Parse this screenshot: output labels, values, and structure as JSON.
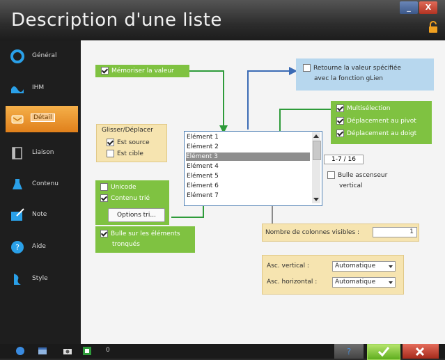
{
  "window": {
    "title": "Description d'une liste",
    "minimize_label": "_",
    "close_label": "X"
  },
  "sidebar": {
    "items": [
      {
        "label": "Général",
        "icon": "circle-icon"
      },
      {
        "label": "IHM",
        "icon": "screen-icon"
      },
      {
        "label": "Détail",
        "icon": "detail-icon"
      },
      {
        "label": "Liaison",
        "icon": "link-icon"
      },
      {
        "label": "Contenu",
        "icon": "content-icon"
      },
      {
        "label": "Note",
        "icon": "note-icon"
      },
      {
        "label": "Aide",
        "icon": "help-icon"
      },
      {
        "label": "Style",
        "icon": "style-icon"
      }
    ],
    "active_index": 2
  },
  "content": {
    "memorize": {
      "label": "Mémoriser la valeur",
      "checked": true
    },
    "gLien": {
      "label_line1": "Retourne la valeur spécifiée",
      "label_line2": "avec la fonction gLien",
      "checked": false
    },
    "multiselection": {
      "label": "Multisélection",
      "checked": true
    },
    "move_mouse": {
      "label": "Déplacement au pivot",
      "checked": true
    },
    "move_finger": {
      "label": "Déplacement au doigt",
      "checked": true
    },
    "drag": {
      "title": "Glisser/Déplacer",
      "source": {
        "label": "Est source",
        "checked": true
      },
      "target": {
        "label": "Est cible",
        "checked": false
      }
    },
    "list": {
      "items": [
        "Elément 1",
        "Elément 2",
        "Elément 3",
        "Elément 4",
        "Elément 5",
        "Elément 6",
        "Elément 7"
      ],
      "selected_index": 2
    },
    "counter": "1-7 / 16",
    "vertical_scroll_tip": {
      "label_line1": "Bulle ascenseur",
      "label_line2": "vertical",
      "checked": false
    },
    "unicode": {
      "label": "Unicode",
      "checked": false
    },
    "sorted": {
      "label": "Contenu trié",
      "checked": true
    },
    "sort_options_button": "Options tri...",
    "truncated_tip": {
      "label_line1": "Bulle sur les éléments",
      "label_line2": "tronqués",
      "checked": true
    },
    "visible_columns": {
      "label": "Nombre de colonnes visibles :",
      "value": "1"
    },
    "scroll_vertical": {
      "label": "Asc. vertical :",
      "value": "Automatique"
    },
    "scroll_horizontal": {
      "label": "Asc. horizontal :",
      "value": "Automatique"
    }
  },
  "bottom_bar": {
    "counter": "0"
  },
  "colors": {
    "accent_orange": "#e8901f",
    "green_box": "#7fc241",
    "yellow_box": "#f6e4b0",
    "blue_box": "#b7d7ee",
    "connector_blue": "#3b6bb5",
    "connector_green": "#2e9b3a"
  }
}
